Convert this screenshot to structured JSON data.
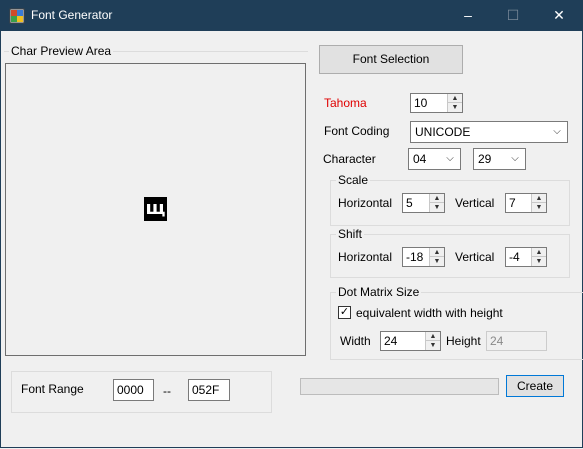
{
  "window": {
    "title": "Font Generator",
    "minimize": "–",
    "maximize": "☐",
    "close": "✕"
  },
  "preview": {
    "group_title": "Char Preview Area",
    "glyph": "щ"
  },
  "font": {
    "selection_button": "Font Selection",
    "name": "Tahoma",
    "name_color": "#e00000",
    "size": "10",
    "coding_label": "Font Coding",
    "coding_value": "UNICODE",
    "character_label": "Character",
    "char_high": "04",
    "char_low": "29"
  },
  "scale": {
    "title": "Scale",
    "horizontal_label": "Horizontal",
    "horizontal_value": "5",
    "vertical_label": "Vertical",
    "vertical_value": "7"
  },
  "shift": {
    "title": "Shift",
    "horizontal_label": "Horizontal",
    "horizontal_value": "-18",
    "vertical_label": "Vertical",
    "vertical_value": "-4"
  },
  "dot_matrix": {
    "title": "Dot Matrix Size",
    "checkbox_label": "equivalent width with height",
    "checked": true,
    "width_label": "Width",
    "width_value": "24",
    "height_label": "Height",
    "height_value": "24"
  },
  "range": {
    "label": "Font Range",
    "from": "0000",
    "separator": "--",
    "to": "052F"
  },
  "actions": {
    "create": "Create",
    "progress": 0
  }
}
